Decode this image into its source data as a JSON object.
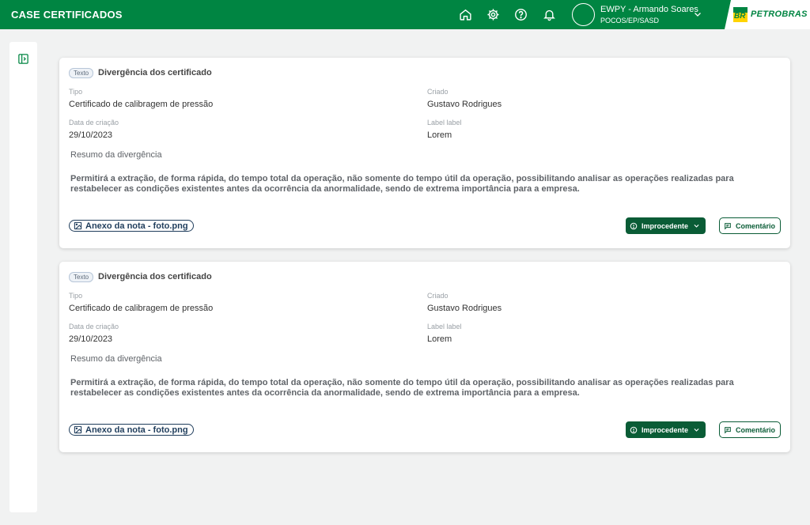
{
  "app": {
    "title": "CASE CERTIFICADOS"
  },
  "user": {
    "name": "EWPY - Armando Soares",
    "department": "POCOS/EP/SASD"
  },
  "brand": {
    "mark": "BR",
    "name": "PETROBRAS",
    "colors": {
      "green": "#008542",
      "yellow": "#ffd400"
    }
  },
  "header_icons": [
    "home-icon",
    "gear-icon",
    "help-icon",
    "bell-icon",
    "chevron-down-icon"
  ],
  "colors": {
    "primary": "#008542",
    "button_dark": "#0a5c36",
    "link": "#1f3d5c"
  },
  "cards": [
    {
      "tag": "Texto",
      "title": "Divergência dos certificado",
      "tipo_label": "Tipo",
      "tipo_value": "Certificado de calibragem de pressão",
      "criado_label": "Criado",
      "criado_value": "Gustavo Rodrigues",
      "data_label": "Data de criação",
      "data_value": "29/10/2023",
      "extra_label": "Label label",
      "extra_value": "Lorem",
      "summary_label": "Resumo da divergência",
      "summary_text": "Permitirá a extração, de forma rápida, do tempo total da operação, não somente do tempo útil da operação, possibilitando analisar as operações realizadas para restabelecer as condições existentes antes da ocorrência da anormalidade, sendo de extrema importância para a empresa.",
      "attachment": "Anexo da nota - foto.png",
      "status": "Improcedente",
      "comment": "Comentário"
    },
    {
      "tag": "Texto",
      "title": "Divergência dos certificado",
      "tipo_label": "Tipo",
      "tipo_value": "Certificado de calibragem de pressão",
      "criado_label": "Criado",
      "criado_value": "Gustavo Rodrigues",
      "data_label": "Data de criação",
      "data_value": "29/10/2023",
      "extra_label": "Label label",
      "extra_value": "Lorem",
      "summary_label": "Resumo da divergência",
      "summary_text": "Permitirá a extração, de forma rápida, do tempo total da operação, não somente do tempo útil da operação, possibilitando analisar as operações realizadas para restabelecer as condições existentes antes da ocorrência da anormalidade, sendo de extrema importância para a empresa.",
      "attachment": "Anexo da nota - foto.png",
      "status": "Improcedente",
      "comment": "Comentário"
    }
  ]
}
